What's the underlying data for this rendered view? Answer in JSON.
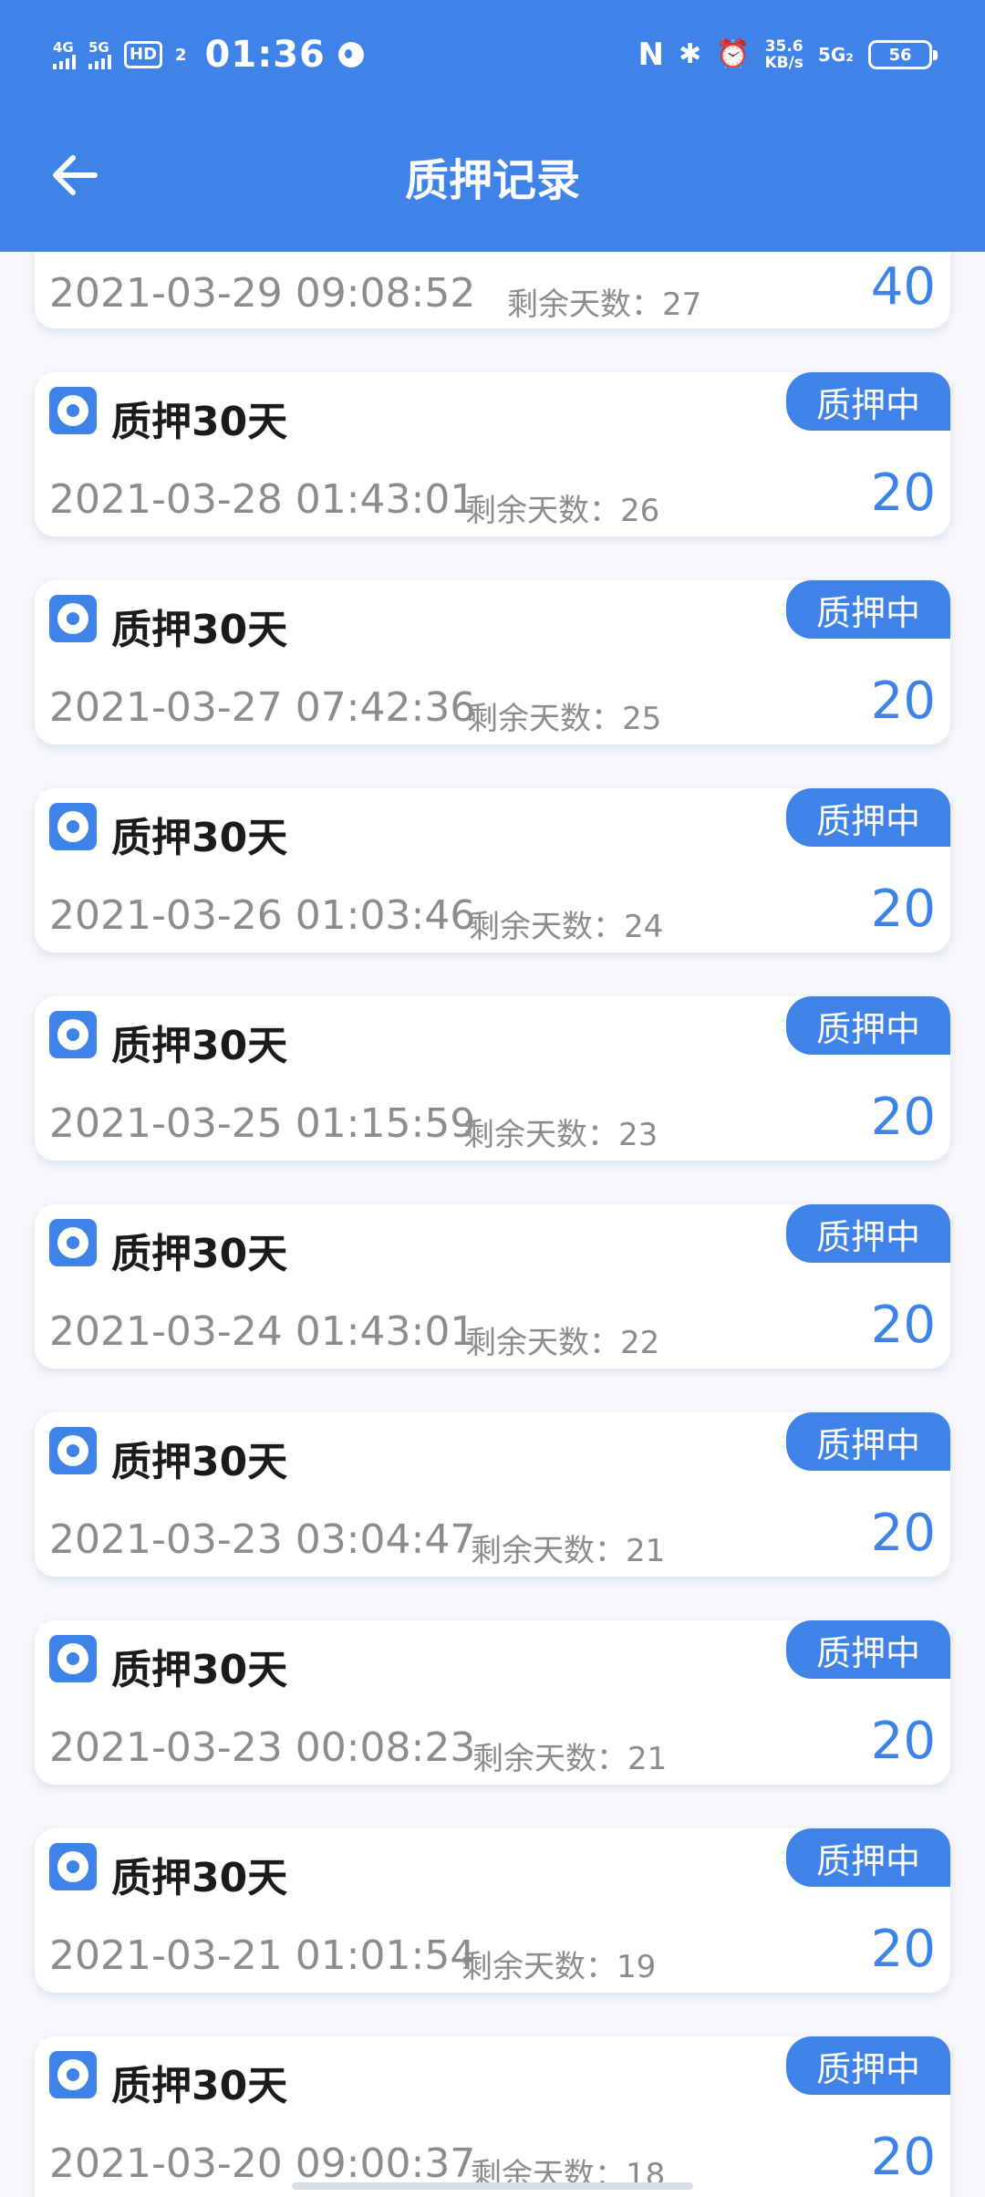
{
  "status_bar": {
    "net1": "4G",
    "net2": "5G",
    "hd": "HD",
    "hd_sub": "2",
    "time": "01:36",
    "nfc": "N",
    "bluetooth": "✱",
    "alarm": "⏰",
    "speed_value": "35.6",
    "speed_unit": "KB/s",
    "net3": "5G₂",
    "battery": "56"
  },
  "header": {
    "title": "质押记录",
    "back_icon": "arrow-left-icon"
  },
  "colors": {
    "primary": "#3f82e8",
    "gray_text": "#8c8c8c",
    "title_text": "#1b1b1b"
  },
  "remain_label": "剩余天数：",
  "records": [
    {
      "title": "",
      "status": "",
      "date": "2021-03-29 09:08:52",
      "remain": "27",
      "amount": "40"
    },
    {
      "title": "质押30天",
      "status": "质押中",
      "date": "2021-03-28 01:43:01",
      "remain": "26",
      "amount": "20"
    },
    {
      "title": "质押30天",
      "status": "质押中",
      "date": "2021-03-27 07:42:36",
      "remain": "25",
      "amount": "20"
    },
    {
      "title": "质押30天",
      "status": "质押中",
      "date": "2021-03-26 01:03:46",
      "remain": "24",
      "amount": "20"
    },
    {
      "title": "质押30天",
      "status": "质押中",
      "date": "2021-03-25 01:15:59",
      "remain": "23",
      "amount": "20"
    },
    {
      "title": "质押30天",
      "status": "质押中",
      "date": "2021-03-24 01:43:01",
      "remain": "22",
      "amount": "20"
    },
    {
      "title": "质押30天",
      "status": "质押中",
      "date": "2021-03-23 03:04:47",
      "remain": "21",
      "amount": "20"
    },
    {
      "title": "质押30天",
      "status": "质押中",
      "date": "2021-03-23 00:08:23",
      "remain": "21",
      "amount": "20"
    },
    {
      "title": "质押30天",
      "status": "质押中",
      "date": "2021-03-21 01:01:54",
      "remain": "19",
      "amount": "20"
    },
    {
      "title": "质押30天",
      "status": "质押中",
      "date": "2021-03-20 09:00:37",
      "remain": "18",
      "amount": "20"
    }
  ]
}
